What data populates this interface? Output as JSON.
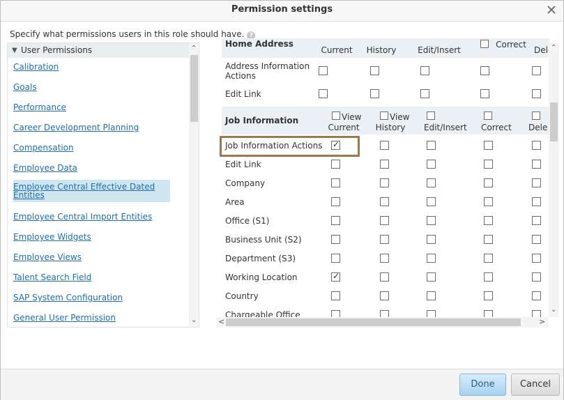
{
  "dialog": {
    "title": "Permission settings",
    "instruction": "Specify what permissions users in this role should have.",
    "help_icon": "?"
  },
  "left": {
    "header": "User Permissions",
    "items": [
      {
        "label": "Calibration",
        "selected": false
      },
      {
        "label": "Goals",
        "selected": false
      },
      {
        "label": "Performance",
        "selected": false
      },
      {
        "label": "Career Development Planning",
        "selected": false
      },
      {
        "label": "Compensation",
        "selected": false
      },
      {
        "label": "Employee Data",
        "selected": false
      },
      {
        "label": "Employee Central Effective Dated",
        "label2": "Entities",
        "selected": true
      },
      {
        "label": "Employee Central Import Entities",
        "selected": false
      },
      {
        "label": "Employee Widgets",
        "selected": false
      },
      {
        "label": "Employee Views",
        "selected": false
      },
      {
        "label": "Talent Search Field",
        "selected": false
      },
      {
        "label": "SAP System Configuration",
        "selected": false
      },
      {
        "label": "General User Permission",
        "selected": false
      }
    ]
  },
  "home": {
    "title": "Home Address",
    "columns": [
      "Current",
      "History",
      "Edit/Insert",
      "Correct",
      "Dele"
    ],
    "rows": [
      {
        "label": "Address Information",
        "label2": "Actions",
        "checks": [
          false,
          false,
          false,
          false,
          false
        ]
      },
      {
        "label": "Edit Link",
        "checks": [
          false,
          false,
          false,
          false,
          false
        ]
      }
    ]
  },
  "job": {
    "title": "Job Information",
    "columns": [
      {
        "line1": "View",
        "line2": "Current"
      },
      {
        "line1": "View",
        "line2": "History"
      },
      {
        "line1": "",
        "line2": "Edit/Insert"
      },
      {
        "line1": "",
        "line2": "Correct"
      },
      {
        "line1": "",
        "line2": "Dele"
      }
    ],
    "rows": [
      {
        "label": "Job Information Actions",
        "checks": [
          true,
          false,
          false,
          false,
          false
        ]
      },
      {
        "label": "Edit Link",
        "checks": [
          false,
          false,
          false,
          false,
          false
        ]
      },
      {
        "label": "Company",
        "checks": [
          false,
          false,
          false,
          false,
          false
        ]
      },
      {
        "label": "Area",
        "checks": [
          false,
          false,
          false,
          false,
          false
        ]
      },
      {
        "label": "Office (S1)",
        "checks": [
          false,
          false,
          false,
          false,
          false
        ]
      },
      {
        "label": "Business Unit (S2)",
        "checks": [
          false,
          false,
          false,
          false,
          false
        ]
      },
      {
        "label": "Department (S3)",
        "checks": [
          false,
          false,
          false,
          false,
          false
        ]
      },
      {
        "label": "Working Location",
        "checks": [
          true,
          false,
          false,
          false,
          false
        ]
      },
      {
        "label": "Country",
        "checks": [
          false,
          false,
          false,
          false,
          false
        ]
      },
      {
        "label": "Chargeable Office",
        "checks": [
          false,
          false,
          false,
          false,
          false
        ]
      }
    ]
  },
  "footer": {
    "done_label": "Done",
    "cancel_label": "Cancel"
  },
  "colors": {
    "link": "#1f6ea8",
    "selected_bg": "#cfe6f1",
    "highlight_border": "#a0764e"
  }
}
